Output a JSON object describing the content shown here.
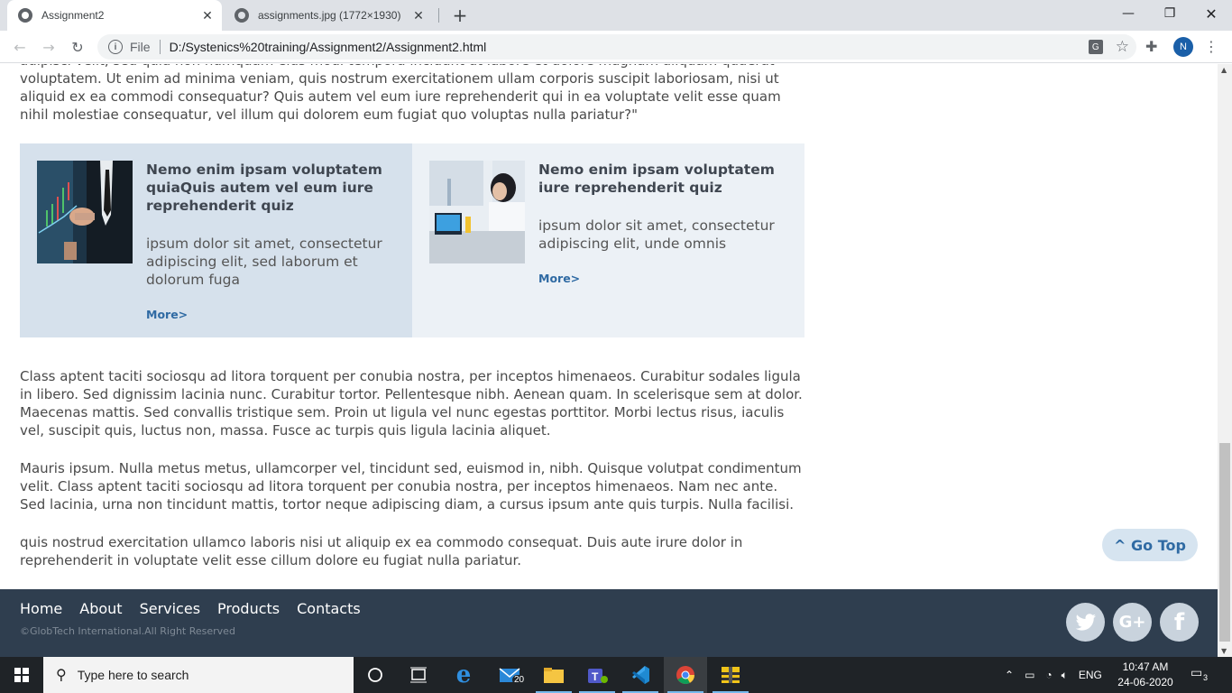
{
  "browser": {
    "tabs": [
      {
        "title": "Assignment2",
        "active": true
      },
      {
        "title": "assignments.jpg (1772×1930)",
        "active": false
      }
    ],
    "scheme": "File",
    "url": "D:/Systenics%20training/Assignment2/Assignment2.html",
    "profile_initial": "N"
  },
  "page": {
    "intro_text": "adipisci velit, sed quia non numquam eius modi tempora incidunt ut labore et dolore magnam aliquam quaerat voluptatem. Ut enim ad minima veniam, quis nostrum exercitationem ullam corporis suscipit laboriosam, nisi ut aliquid ex ea commodi consequatur? Quis autem vel eum iure reprehenderit qui in ea voluptate velit esse quam nihil molestiae consequatur, vel illum qui dolorem eum fugiat quo voluptas nulla pariatur?\"",
    "cards": [
      {
        "title": "Nemo enim ipsam voluptatem quiaQuis autem vel eum iure reprehenderit quiz",
        "text": "ipsum dolor sit amet, consectetur adipiscing elit, sed laborum et dolorum fuga",
        "link": "More>"
      },
      {
        "title": "Nemo enim ipsam voluptatem iure reprehenderit quiz",
        "text": "ipsum dolor sit amet, consectetur adipiscing elit, unde omnis",
        "link": "More>"
      }
    ],
    "para1": "Class aptent taciti sociosqu ad litora torquent per conubia nostra, per inceptos himenaeos. Curabitur sodales ligula in libero. Sed dignissim lacinia nunc. Curabitur tortor. Pellentesque nibh. Aenean quam. In scelerisque sem at dolor. Maecenas mattis. Sed convallis tristique sem. Proin ut ligula vel nunc egestas porttitor. Morbi lectus risus, iaculis vel, suscipit quis, luctus non, massa. Fusce ac turpis quis ligula lacinia aliquet.",
    "para2": "Mauris ipsum. Nulla metus metus, ullamcorper vel, tincidunt sed, euismod in, nibh. Quisque volutpat condimentum velit. Class aptent taciti sociosqu ad litora torquent per conubia nostra, per inceptos himenaeos. Nam nec ante. Sed lacinia, urna non tincidunt mattis, tortor neque adipiscing diam, a cursus ipsum ante quis turpis. Nulla facilisi.",
    "para3": "quis nostrud exercitation ullamco laboris nisi ut aliquip ex ea commodo consequat. Duis aute irure dolor in reprehenderit in voluptate velit esse cillum dolore eu fugiat nulla pariatur.",
    "go_top": "^ Go Top"
  },
  "footer": {
    "nav": [
      "Home",
      "About",
      "Services",
      "Products",
      "Contacts"
    ],
    "copyright": "©GlobTech International.All Right Reserved",
    "social": [
      "twitter-icon",
      "google-plus-icon",
      "facebook-icon"
    ]
  },
  "taskbar": {
    "search_placeholder": "Type here to search",
    "mail_badge": "20",
    "language": "ENG",
    "time": "10:47 AM",
    "date": "24-06-2020",
    "notification_count": "3"
  },
  "colors": {
    "footer_bg": "#2f3e4f",
    "card1_bg": "#d6e1ec",
    "card2_bg": "#ecf1f6",
    "link": "#2f6aa3"
  }
}
